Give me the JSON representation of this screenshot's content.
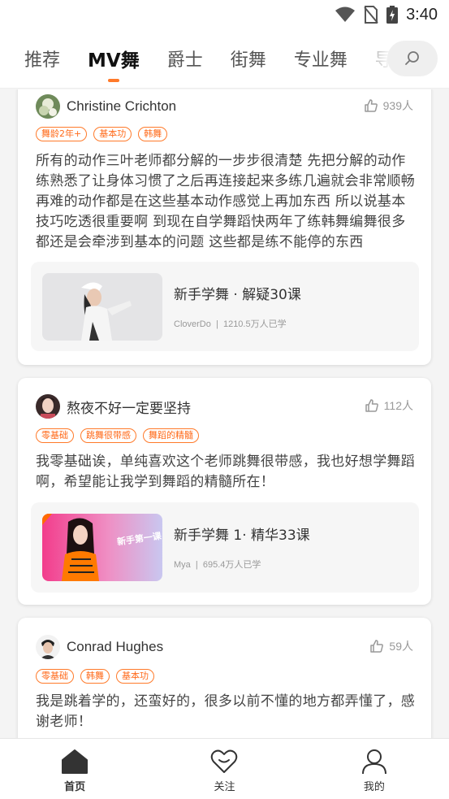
{
  "status": {
    "time": "3:40"
  },
  "tabs": [
    {
      "label": "推荐"
    },
    {
      "label": "MV舞"
    },
    {
      "label": "爵士"
    },
    {
      "label": "街舞"
    },
    {
      "label": "专业舞"
    },
    {
      "label": "导"
    }
  ],
  "posts": [
    {
      "username": "Christine Crichton",
      "likes": "939人",
      "tags": [
        "舞龄2年+",
        "基本功",
        "韩舞"
      ],
      "comment": "所有的动作三叶老师都分解的一步步很清楚 先把分解的动作练熟悉了让身体习惯了之后再连接起来多练几遍就会非常顺畅 再难的动作都是在这些基本动作感觉上再加东西 所以说基本技巧吃透很重要啊 到现在自学舞蹈快两年了练韩舞编舞很多都还是会牵涉到基本的问题 这些都是练不能停的东西",
      "course": {
        "title": "新手学舞 · 解疑30课",
        "teacher": "CloverDo",
        "learners": "1210.5万人已学"
      }
    },
    {
      "username": "熬夜不好一定要坚持",
      "likes": "112人",
      "tags": [
        "零基础",
        "跳舞很带感",
        "舞蹈的精髓"
      ],
      "comment": "我零基础诶，单纯喜欢这个老师跳舞很带感，我也好想学舞蹈啊，希望能让我学到舞蹈的精髓所在！",
      "course": {
        "title": "新手学舞 1· 精华33课",
        "teacher": "Mya",
        "learners": "695.4万人已学",
        "thumb_text": "新手第一课"
      }
    },
    {
      "username": "Conrad Hughes",
      "likes": "59人",
      "tags": [
        "零基础",
        "韩舞",
        "基本功"
      ],
      "comment": "我是跳着学的，还蛮好的，很多以前不懂的地方都弄懂了，感谢老师！"
    }
  ],
  "bottom_nav": [
    {
      "label": "首页",
      "icon": "home-icon"
    },
    {
      "label": "关注",
      "icon": "heart-icon"
    },
    {
      "label": "我的",
      "icon": "person-icon"
    }
  ],
  "colors": {
    "accent": "#ff7a2a",
    "background": "#f4f4f4"
  }
}
